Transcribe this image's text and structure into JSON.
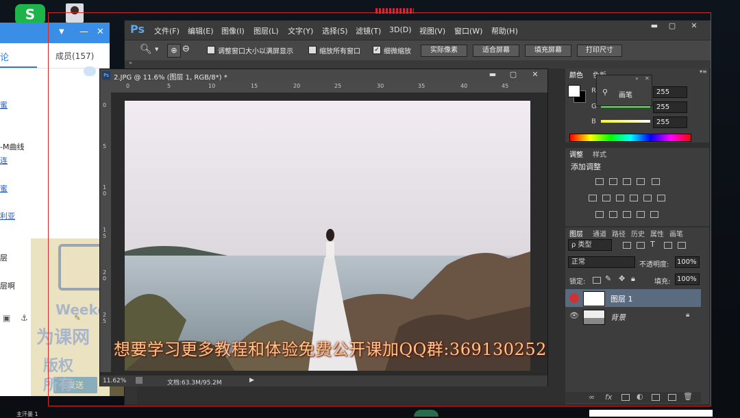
{
  "desktop": {
    "app_icon_label": "S"
  },
  "chat": {
    "tab_discuss": "论",
    "tab_members": "成员(157)",
    "messages": [
      "蜜",
      "-M曲线",
      "连",
      "蜜",
      "利亚",
      "层",
      "层啊"
    ],
    "send_label": "发送",
    "bottom_name": "主汗墨 1",
    "watermark_lines": [
      "Weekend",
      "为课网",
      "版权",
      "所有"
    ]
  },
  "ps": {
    "logo": "Ps",
    "menus": [
      "文件(F)",
      "编辑(E)",
      "图像(I)",
      "图层(L)",
      "文字(Y)",
      "选择(S)",
      "滤镜(T)",
      "3D(D)",
      "视图(V)",
      "窗口(W)",
      "帮助(H)"
    ],
    "options": {
      "fit_window": "调整窗口大小以满屏显示",
      "zoom_all": "缩放所有窗口",
      "scrubby": "细微缩放",
      "actual_pixels": "实际像素",
      "fit_screen": "适合屏幕",
      "fill_screen": "填充屏幕",
      "print_size": "打印尺寸"
    },
    "document": {
      "title": "2.JPG @ 11.6% (图层 1, RGB/8*) *",
      "ruler_h": [
        "0",
        "5",
        "10",
        "15",
        "20",
        "25",
        "30",
        "35",
        "40",
        "45"
      ],
      "ruler_v": [
        "0",
        "5",
        "1 0",
        "1 5",
        "2 0",
        "2 5"
      ],
      "zoom": "11.62%",
      "doc_info": "文档:63.3M/95.2M"
    },
    "color_panel": {
      "tab_color": "颜色",
      "tab_swatch": "色板",
      "r_label": "R",
      "g_label": "G",
      "b_label": "B",
      "r": "255",
      "g": "255",
      "b": "255"
    },
    "brush_popup_label": "画笔",
    "adjust_panel": {
      "tab_adjust": "调整",
      "tab_style": "样式",
      "add_adjust": "添加调整"
    },
    "layers_panel": {
      "tabs": [
        "图层",
        "通道",
        "路径",
        "历史",
        "属性",
        "画笔"
      ],
      "filter_kind": "ρ 类型",
      "blend_mode": "正常",
      "opacity_label": "不透明度:",
      "opacity": "100%",
      "lock_label": "锁定:",
      "fill_label": "填充:",
      "fill": "100%",
      "layers": [
        {
          "name": "图层 1",
          "selected": true
        },
        {
          "name": "背景",
          "selected": false
        }
      ]
    }
  },
  "subtitle": "想要学习更多教程和体验免费公开课加QQ群:369130252",
  "colors": {
    "ps_bg": "#2f2f2f",
    "accent_blue": "#3a8ee6",
    "record_red": "#d12a2a"
  }
}
